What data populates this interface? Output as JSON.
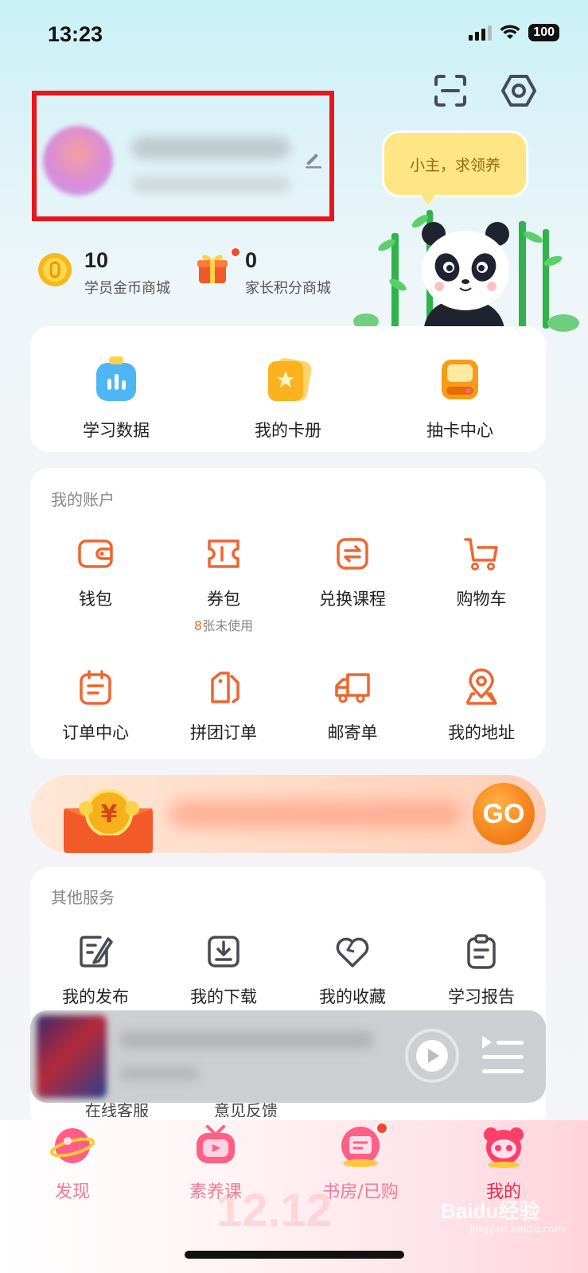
{
  "status_bar": {
    "time": "13:23",
    "battery": "100"
  },
  "speech_bubble": "小主，求领养",
  "points": {
    "student_coins": {
      "value": "10",
      "label": "学员金币商城"
    },
    "parent_points": {
      "value": "0",
      "label": "家长积分商城"
    }
  },
  "quick_actions": [
    {
      "label": "学习数据",
      "icon": "chart-icon"
    },
    {
      "label": "我的卡册",
      "icon": "card-album-icon"
    },
    {
      "label": "抽卡中心",
      "icon": "card-draw-icon"
    }
  ],
  "account": {
    "title": "我的账户",
    "items": [
      {
        "label": "钱包",
        "icon": "wallet-icon"
      },
      {
        "label": "券包",
        "icon": "coupon-icon"
      },
      {
        "label": "兑换课程",
        "icon": "exchange-icon"
      },
      {
        "label": "购物车",
        "icon": "cart-icon"
      },
      {
        "label": "订单中心",
        "icon": "order-icon"
      },
      {
        "label": "拼团订单",
        "icon": "group-order-icon"
      },
      {
        "label": "邮寄单",
        "icon": "truck-icon"
      },
      {
        "label": "我的地址",
        "icon": "location-icon"
      }
    ],
    "coupon_note": {
      "count": "8",
      "text": "张未使用"
    }
  },
  "banner": {
    "go": "GO"
  },
  "services": {
    "title": "其他服务",
    "items": [
      {
        "label": "我的发布",
        "icon": "edit-note-icon"
      },
      {
        "label": "我的下载",
        "icon": "download-icon"
      },
      {
        "label": "我的收藏",
        "icon": "heart-icon"
      },
      {
        "label": "学习报告",
        "icon": "report-icon"
      }
    ],
    "partially_hidden": [
      "在线客服",
      "意见反馈"
    ]
  },
  "tabs": [
    {
      "label": "发现",
      "icon": "planet-icon"
    },
    {
      "label": "素养课",
      "icon": "tv-icon"
    },
    {
      "label": "书房/已购",
      "icon": "bookroom-icon"
    },
    {
      "label": "我的",
      "icon": "panda-face-icon",
      "active": true
    }
  ],
  "promo_text": "12.12",
  "watermark": {
    "main": "Baidu经验",
    "sub": "jingyan.baidu.com"
  },
  "colors": {
    "accent_orange": "#f36b2b",
    "active_tab": "#e8294a",
    "tab_text": "#f27a98",
    "highlight_box": "#e6171d"
  }
}
